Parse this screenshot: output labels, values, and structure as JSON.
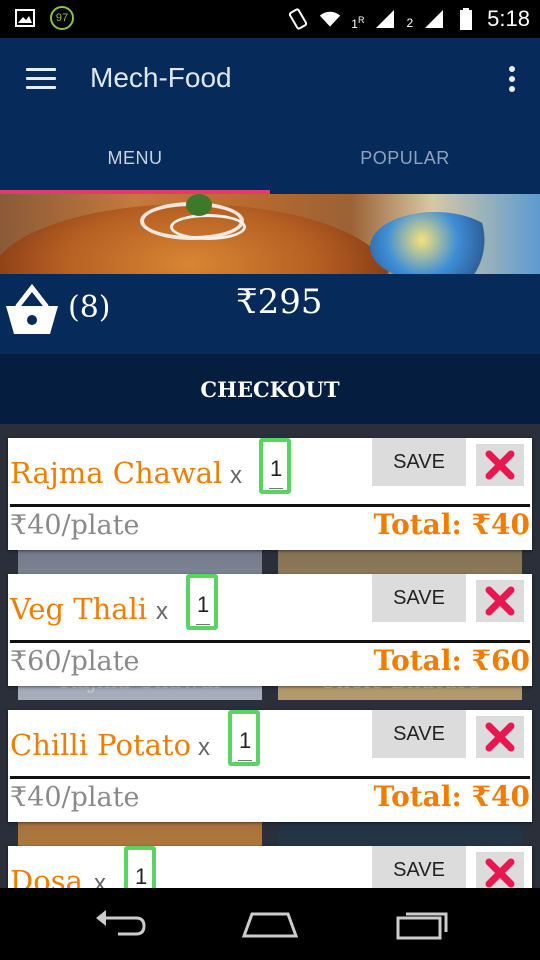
{
  "status_bar": {
    "badge": "97",
    "sim1": "1",
    "sim1_roaming": "R",
    "sim2": "2",
    "time": "5:18"
  },
  "app_bar": {
    "title": "Mech-Food"
  },
  "tabs": [
    {
      "label": "MENU",
      "active": true
    },
    {
      "label": "POPULAR",
      "active": false
    }
  ],
  "cart": {
    "count": "(8)",
    "total": "₹295"
  },
  "checkout_label": "CHECKOUT",
  "background_tiles": [
    {
      "label": "Rajma Chawal"
    },
    {
      "label": "Chole Bhature"
    }
  ],
  "items": [
    {
      "name": "Rajma Chawal",
      "times": "x",
      "qty": "1",
      "save": "SAVE",
      "rate": "₹40/plate",
      "total": "Total:  ₹40"
    },
    {
      "name": "Veg Thali",
      "times": "x",
      "qty": "1",
      "save": "SAVE",
      "rate": "₹60/plate",
      "total": "Total:  ₹60"
    },
    {
      "name": "Chilli Potato",
      "times": "x",
      "qty": "1",
      "save": "SAVE",
      "rate": "₹40/plate",
      "total": "Total:  ₹40"
    },
    {
      "name": "Dosa",
      "times": "x",
      "qty": "1",
      "save": "SAVE",
      "rate": "",
      "total": ""
    }
  ],
  "colors": {
    "primary": "#062a59",
    "accent": "#e23a6b",
    "item_orange": "#f07d00",
    "qty_border": "#5bd363",
    "delete_red": "#e8174f"
  }
}
